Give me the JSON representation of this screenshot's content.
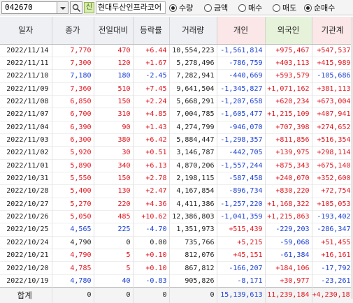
{
  "toolbar": {
    "code": "042670",
    "market_badge": "신",
    "stock_name": "현대두산인프라코어",
    "radios": [
      {
        "label": "수량",
        "checked": true
      },
      {
        "label": "금액",
        "checked": false
      },
      {
        "label": "매수",
        "checked": false
      },
      {
        "label": "매도",
        "checked": false
      },
      {
        "label": "순매수",
        "checked": true
      }
    ]
  },
  "columns": [
    "일자",
    "종가",
    "전일대비",
    "등락률",
    "거래량",
    "개인",
    "외국인",
    "기관계"
  ],
  "rows": [
    {
      "date": "2022/11/14",
      "close": "7,770",
      "change": "470",
      "rate": "+6.44",
      "volume": "10,554,223",
      "individual": "-1,561,814",
      "foreign": "+975,467",
      "institution": "+547,537",
      "dir": "up"
    },
    {
      "date": "2022/11/11",
      "close": "7,300",
      "change": "120",
      "rate": "+1.67",
      "volume": "5,278,496",
      "individual": "-786,759",
      "foreign": "+403,113",
      "institution": "+415,989",
      "dir": "up"
    },
    {
      "date": "2022/11/10",
      "close": "7,180",
      "change": "180",
      "rate": "-2.45",
      "volume": "7,282,941",
      "individual": "-440,669",
      "foreign": "+593,579",
      "institution": "-105,686",
      "dir": "down"
    },
    {
      "date": "2022/11/09",
      "close": "7,360",
      "change": "510",
      "rate": "+7.45",
      "volume": "9,641,504",
      "individual": "-1,345,827",
      "foreign": "+1,071,162",
      "institution": "+381,113",
      "dir": "up"
    },
    {
      "date": "2022/11/08",
      "close": "6,850",
      "change": "150",
      "rate": "+2.24",
      "volume": "5,668,291",
      "individual": "-1,207,658",
      "foreign": "+620,234",
      "institution": "+673,004",
      "dir": "up"
    },
    {
      "date": "2022/11/07",
      "close": "6,700",
      "change": "310",
      "rate": "+4.85",
      "volume": "7,004,785",
      "individual": "-1,605,477",
      "foreign": "+1,215,109",
      "institution": "+407,941",
      "dir": "up"
    },
    {
      "date": "2022/11/04",
      "close": "6,390",
      "change": "90",
      "rate": "+1.43",
      "volume": "4,274,799",
      "individual": "-946,070",
      "foreign": "+707,398",
      "institution": "+274,652",
      "dir": "up"
    },
    {
      "date": "2022/11/03",
      "close": "6,300",
      "change": "380",
      "rate": "+6.42",
      "volume": "5,884,447",
      "individual": "-1,298,357",
      "foreign": "+811,856",
      "institution": "+516,354",
      "dir": "up"
    },
    {
      "date": "2022/11/02",
      "close": "5,920",
      "change": "30",
      "rate": "+0.51",
      "volume": "3,146,787",
      "individual": "-442,705",
      "foreign": "+139,975",
      "institution": "+298,114",
      "dir": "up"
    },
    {
      "date": "2022/11/01",
      "close": "5,890",
      "change": "340",
      "rate": "+6.13",
      "volume": "4,870,206",
      "individual": "-1,557,244",
      "foreign": "+875,343",
      "institution": "+675,140",
      "dir": "up"
    },
    {
      "date": "2022/10/31",
      "close": "5,550",
      "change": "150",
      "rate": "+2.78",
      "volume": "2,198,115",
      "individual": "-587,458",
      "foreign": "+240,070",
      "institution": "+352,600",
      "dir": "up"
    },
    {
      "date": "2022/10/28",
      "close": "5,400",
      "change": "130",
      "rate": "+2.47",
      "volume": "4,167,854",
      "individual": "-896,734",
      "foreign": "+830,220",
      "institution": "+72,754",
      "dir": "up"
    },
    {
      "date": "2022/10/27",
      "close": "5,270",
      "change": "220",
      "rate": "+4.36",
      "volume": "4,411,386",
      "individual": "-1,257,220",
      "foreign": "+1,168,322",
      "institution": "+105,053",
      "dir": "up"
    },
    {
      "date": "2022/10/26",
      "close": "5,050",
      "change": "485",
      "rate": "+10.62",
      "volume": "12,386,803",
      "individual": "-1,041,359",
      "foreign": "+1,215,863",
      "institution": "-193,402",
      "dir": "up"
    },
    {
      "date": "2022/10/25",
      "close": "4,565",
      "change": "225",
      "rate": "-4.70",
      "volume": "1,351,973",
      "individual": "+515,439",
      "foreign": "-229,203",
      "institution": "-286,347",
      "dir": "down"
    },
    {
      "date": "2022/10/24",
      "close": "4,790",
      "change": "0",
      "rate": "0.00",
      "volume": "735,766",
      "individual": "+5,215",
      "foreign": "-59,068",
      "institution": "+51,455",
      "dir": "flat"
    },
    {
      "date": "2022/10/21",
      "close": "4,790",
      "change": "5",
      "rate": "+0.10",
      "volume": "812,076",
      "individual": "+45,151",
      "foreign": "-61,384",
      "institution": "+16,161",
      "dir": "up"
    },
    {
      "date": "2022/10/20",
      "close": "4,785",
      "change": "5",
      "rate": "+0.10",
      "volume": "867,812",
      "individual": "-166,207",
      "foreign": "+184,106",
      "institution": "-17,792",
      "dir": "up"
    },
    {
      "date": "2022/10/19",
      "close": "4,780",
      "change": "40",
      "rate": "-0.83",
      "volume": "905,826",
      "individual": "-8,171",
      "foreign": "+30,977",
      "institution": "-23,261",
      "dir": "down"
    }
  ],
  "totals": {
    "label": "합계",
    "close": "0",
    "change": "0",
    "rate": "0",
    "volume": "0",
    "individual": "15,139,613",
    "foreign": "11,239,184",
    "institution": "+4,230,181"
  },
  "colors": {
    "up": "#e0161f",
    "down": "#1a3fd2",
    "flat": "#222222"
  }
}
